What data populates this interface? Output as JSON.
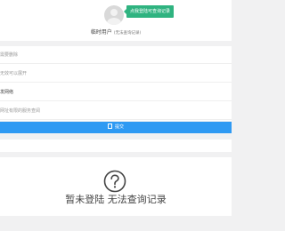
{
  "header": {
    "login_tip": "点我登陆可查询记录",
    "user_name": "临时用户",
    "user_note": "(无法查询记录)"
  },
  "form": {
    "fields": [
      {
        "text": "需要删除"
      },
      {
        "text": "无效可以展开"
      },
      {
        "text": "发网络"
      },
      {
        "text": "网址有限的服务查阅"
      }
    ],
    "submit_label": "提交"
  },
  "empty_state": {
    "icon": "question-circle-icon",
    "message": "暂未登陆 无法查询记录"
  }
}
